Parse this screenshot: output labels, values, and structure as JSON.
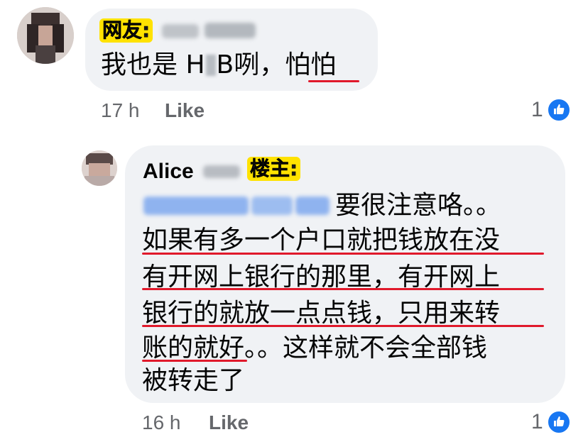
{
  "comment1": {
    "tag": "网友:",
    "text_before": "我也是 H",
    "text_after": "B咧，",
    "text_underlined": "怕怕",
    "time": "17 h",
    "like_label": "Like",
    "like_count": "1"
  },
  "comment2": {
    "author": "Alice",
    "tag": "楼主:",
    "lines": [
      "要很注意咯。。",
      "如果有多一个户口就把钱放在没",
      "有开网上银行的那里，有开网上",
      "银行的就放一点点钱，只用来转",
      "账的就好。。这样就不会全部钱",
      "被转走了"
    ],
    "line5_underlined": "账的就好",
    "line5_rest": "。。这样就不会全部钱",
    "time": "16 h",
    "like_label": "Like",
    "like_count": "1"
  },
  "colors": {
    "bubble": "#f0f2f5",
    "underline": "#e0192b",
    "tag_bg": "#ffe200",
    "like_blue": "#1877f2",
    "meta_gray": "#65676b",
    "blur_blue": "#8fb3ef"
  },
  "icons": [
    "thumbs-up-icon"
  ]
}
